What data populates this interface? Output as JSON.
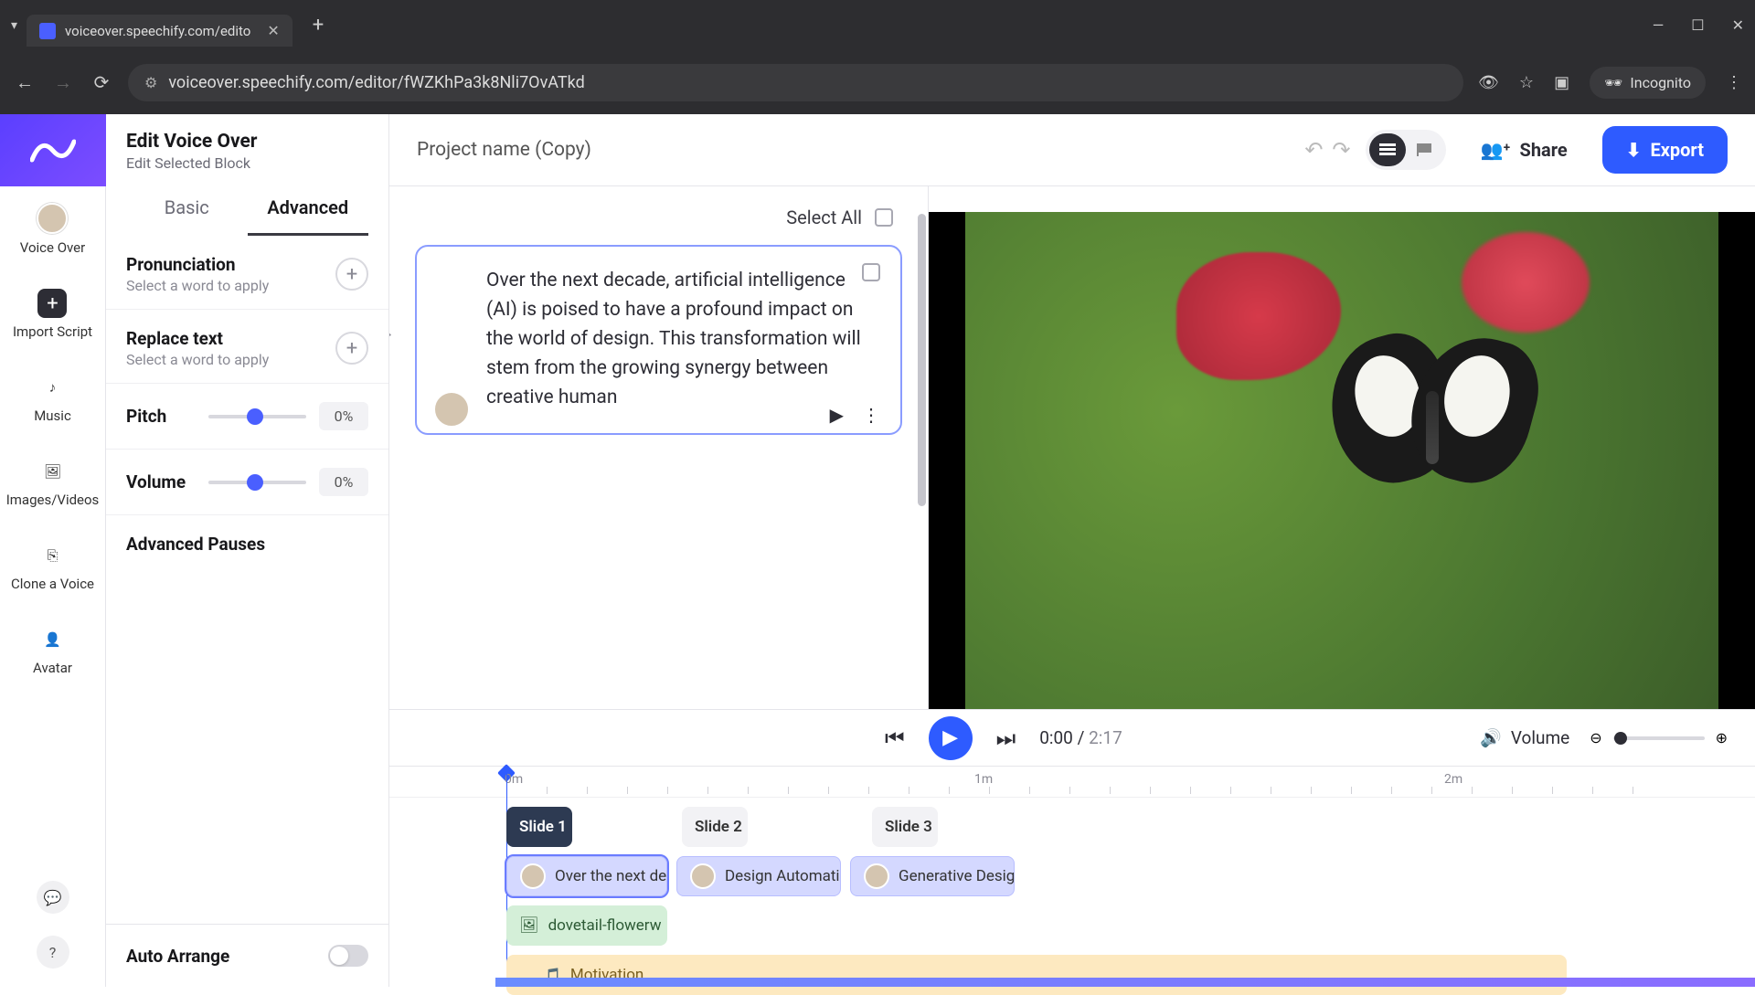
{
  "browser": {
    "tab_title": "voiceover.speechify.com/edito",
    "url": "voiceover.speechify.com/editor/fWZKhPa3k8Nli7OvATkd",
    "incognito": "Incognito"
  },
  "rail": {
    "voice_over": "Voice Over",
    "import_script": "Import Script",
    "music": "Music",
    "images_videos": "Images/Videos",
    "clone_voice": "Clone a Voice",
    "avatar": "Avatar"
  },
  "edit_panel": {
    "title": "Edit Voice Over",
    "subtitle": "Edit Selected Block",
    "tab_basic": "Basic",
    "tab_advanced": "Advanced",
    "pronunciation": {
      "title": "Pronunciation",
      "sub": "Select a word to apply"
    },
    "replace": {
      "title": "Replace text",
      "sub": "Select a word to apply"
    },
    "pitch": {
      "label": "Pitch",
      "value": "0%"
    },
    "volume": {
      "label": "Volume",
      "value": "0%"
    },
    "adv_pauses": "Advanced Pauses",
    "auto_arrange": "Auto Arrange"
  },
  "topbar": {
    "project_name": "Project name (Copy)",
    "share": "Share",
    "export": "Export"
  },
  "script": {
    "select_all": "Select All",
    "block_text": "Over the next decade, artificial intelligence (AI) is poised to have a profound impact on the world of design. This transformation will stem from the growing synergy between creative human"
  },
  "playback": {
    "current": "0:00",
    "duration": "2:17",
    "volume_label": "Volume"
  },
  "timeline": {
    "m0": "0m",
    "m1": "1m",
    "m2": "2m",
    "slide1": "Slide 1",
    "slide2": "Slide 2",
    "slide3": "Slide 3",
    "clip1": "Over the next de",
    "clip2": "Design Automation",
    "clip3": "Generative Desig",
    "media1": "dovetail-flowerw",
    "music1": "Motivation"
  }
}
